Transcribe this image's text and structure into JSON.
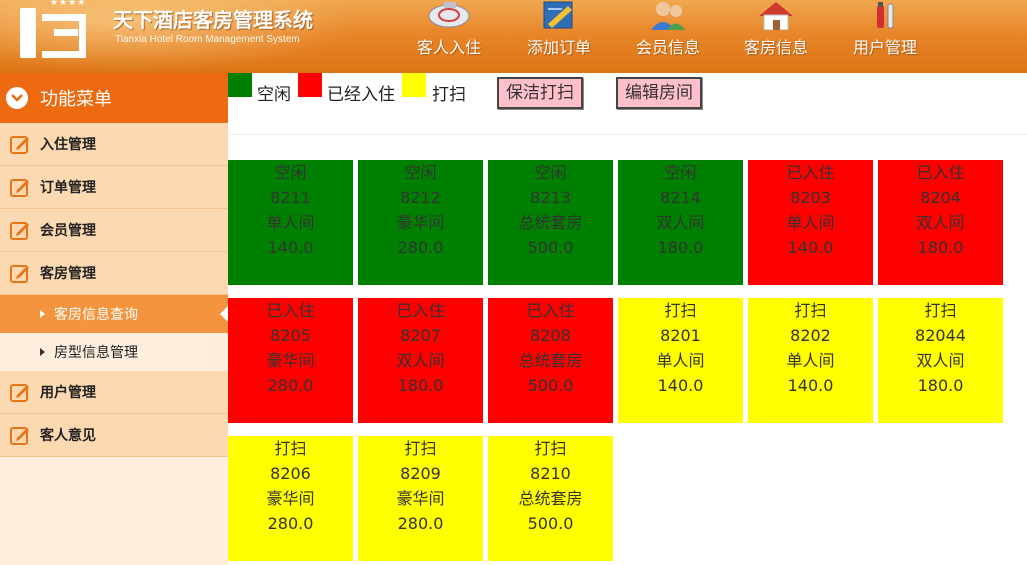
{
  "header": {
    "title": "天下酒店客房管理系统",
    "subtitle": "Tianxia Hotel Room Management System",
    "nav": [
      {
        "label": "客人入住",
        "icon": "guest-checkin-icon"
      },
      {
        "label": "添加订单",
        "icon": "add-order-icon"
      },
      {
        "label": "会员信息",
        "icon": "member-info-icon"
      },
      {
        "label": "客房信息",
        "icon": "room-info-icon"
      },
      {
        "label": "用户管理",
        "icon": "user-management-icon"
      }
    ]
  },
  "sidebar": {
    "title": "功能菜单",
    "items": [
      {
        "label": "入住管理"
      },
      {
        "label": "订单管理"
      },
      {
        "label": "会员管理"
      },
      {
        "label": "客房管理"
      }
    ],
    "subitems": [
      {
        "label": "客房信息查询",
        "active": true
      },
      {
        "label": "房型信息管理",
        "active": false
      }
    ],
    "items_after": [
      {
        "label": "用户管理"
      },
      {
        "label": "客人意见"
      }
    ]
  },
  "legend": {
    "vacant": {
      "label": "空闲",
      "color": "#008000"
    },
    "occupied": {
      "label": "已经入住",
      "color": "#ff0000"
    },
    "cleaning": {
      "label": "打扫",
      "color": "#ffff00"
    }
  },
  "buttons": {
    "clean": "保洁打扫",
    "edit": "编辑房间"
  },
  "rooms": [
    {
      "status": "空闲",
      "number": "8211",
      "type": "单人间",
      "price": "140.0",
      "color": "#008000"
    },
    {
      "status": "空闲",
      "number": "8212",
      "type": "豪华间",
      "price": "280.0",
      "color": "#008000"
    },
    {
      "status": "空闲",
      "number": "8213",
      "type": "总统套房",
      "price": "500.0",
      "color": "#008000"
    },
    {
      "status": "空闲",
      "number": "8214",
      "type": "双人间",
      "price": "180.0",
      "color": "#008000"
    },
    {
      "status": "已入住",
      "number": "8203",
      "type": "单人间",
      "price": "140.0",
      "color": "#ff0000"
    },
    {
      "status": "已入住",
      "number": "8204",
      "type": "双人间",
      "price": "180.0",
      "color": "#ff0000"
    },
    {
      "status": "已入住",
      "number": "8205",
      "type": "豪华间",
      "price": "280.0",
      "color": "#ff0000"
    },
    {
      "status": "已入住",
      "number": "8207",
      "type": "双人间",
      "price": "180.0",
      "color": "#ff0000"
    },
    {
      "status": "已入住",
      "number": "8208",
      "type": "总统套房",
      "price": "500.0",
      "color": "#ff0000"
    },
    {
      "status": "打扫",
      "number": "8201",
      "type": "单人间",
      "price": "140.0",
      "color": "#ffff00"
    },
    {
      "status": "打扫",
      "number": "8202",
      "type": "单人间",
      "price": "140.0",
      "color": "#ffff00"
    },
    {
      "status": "打扫",
      "number": "82044",
      "type": "双人间",
      "price": "180.0",
      "color": "#ffff00"
    },
    {
      "status": "打扫",
      "number": "8206",
      "type": "豪华间",
      "price": "280.0",
      "color": "#ffff00"
    },
    {
      "status": "打扫",
      "number": "8209",
      "type": "豪华间",
      "price": "280.0",
      "color": "#ffff00"
    },
    {
      "status": "打扫",
      "number": "8210",
      "type": "总统套房",
      "price": "500.0",
      "color": "#ffff00"
    }
  ]
}
